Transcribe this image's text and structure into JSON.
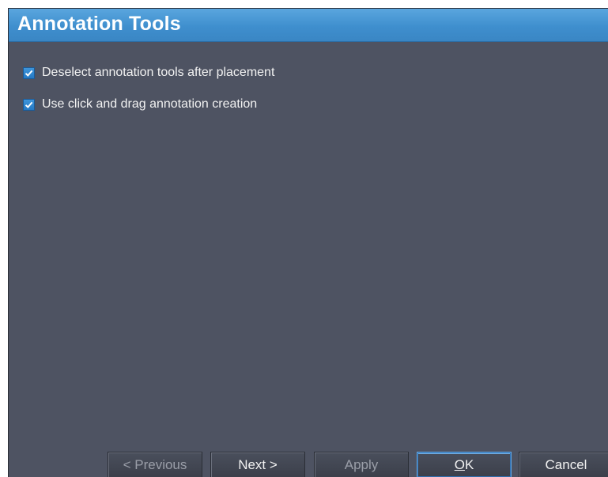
{
  "dialog": {
    "title": "Annotation Tools"
  },
  "options": [
    {
      "label": "Deselect annotation tools after placement",
      "checked": true
    },
    {
      "label": "Use click and drag annotation creation",
      "checked": true
    }
  ],
  "buttons": {
    "previous": "< Previous",
    "next": "Next >",
    "apply": "Apply",
    "ok_mnemonic": "O",
    "ok_rest": "K",
    "cancel": "Cancel"
  },
  "colors": {
    "title_bar": "#3f8fce",
    "panel_background": "#4e5362",
    "checkbox_accent": "#2479c4"
  }
}
